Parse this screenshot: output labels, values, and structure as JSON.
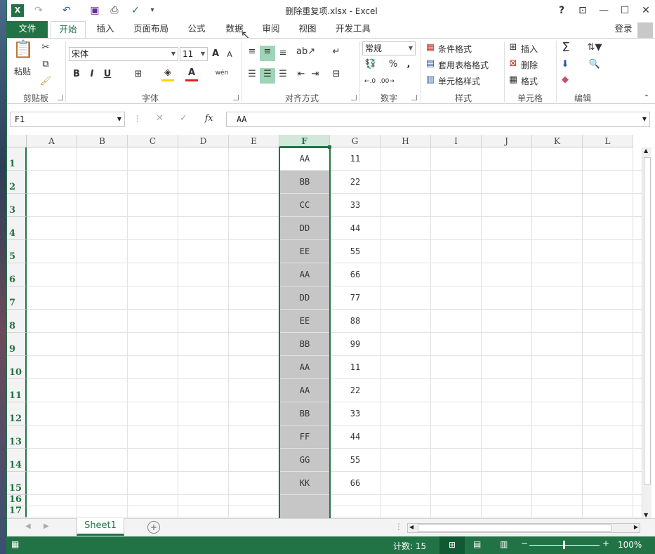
{
  "app": {
    "title": "删除重复项.xlsx - Excel",
    "login": "登录",
    "help": "?"
  },
  "tabs": [
    "文件",
    "开始",
    "插入",
    "页面布局",
    "公式",
    "数据",
    "审阅",
    "视图",
    "开发工具"
  ],
  "ribbon": {
    "clipboard": {
      "paste": "粘贴",
      "label": "剪贴板"
    },
    "font": {
      "name": "宋体",
      "size": "11",
      "label": "字体",
      "bold": "B",
      "italic": "I",
      "underline": "U",
      "grow": "A",
      "shrink": "A",
      "wen": "wén"
    },
    "alignment": {
      "label": "对齐方式"
    },
    "number": {
      "format": "常规",
      "label": "数字",
      "percent": "%",
      "comma": ","
    },
    "styles": {
      "cond": "条件格式",
      "table": "套用表格格式",
      "cell": "单元格样式",
      "label": "样式"
    },
    "cells": {
      "insert": "插入",
      "delete": "删除",
      "format": "格式",
      "label": "单元格"
    },
    "editing": {
      "label": "编辑"
    }
  },
  "formula": {
    "namebox": "F1",
    "fx": "fx",
    "value": "AA"
  },
  "columns": [
    "A",
    "B",
    "C",
    "D",
    "E",
    "F",
    "G",
    "H",
    "I",
    "J",
    "K",
    "L"
  ],
  "rows": [
    "1",
    "2",
    "3",
    "4",
    "5",
    "6",
    "7",
    "8",
    "9",
    "10",
    "11",
    "12",
    "13",
    "14",
    "15",
    "16",
    "17"
  ],
  "col_f": [
    "AA",
    "BB",
    "CC",
    "DD",
    "EE",
    "AA",
    "DD",
    "EE",
    "BB",
    "AA",
    "AA",
    "BB",
    "FF",
    "GG",
    "KK"
  ],
  "col_g": [
    "11",
    "22",
    "33",
    "44",
    "55",
    "66",
    "77",
    "88",
    "99",
    "11",
    "22",
    "33",
    "44",
    "55",
    "66"
  ],
  "sheet": {
    "tab": "Sheet1",
    "add": "+"
  },
  "status": {
    "count": "计数: 15",
    "zoom": "100%",
    "minus": "−",
    "plus": "+"
  }
}
